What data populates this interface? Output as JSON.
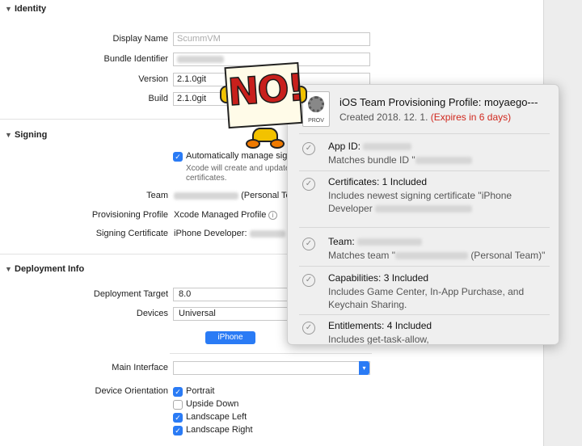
{
  "identity": {
    "header": "Identity",
    "display_name_label": "Display Name",
    "display_name_value": "ScummVM",
    "bundle_id_label": "Bundle Identifier",
    "version_label": "Version",
    "version_value": "2.1.0git",
    "build_label": "Build",
    "build_value": "2.1.0git"
  },
  "signing": {
    "header": "Signing",
    "auto_manage_label": "Automatically manage sign",
    "auto_manage_desc_1": "Xcode will create and update",
    "auto_manage_desc_2": "certificates.",
    "team_label": "Team",
    "team_value_suffix": "(Personal Te",
    "profile_label": "Provisioning Profile",
    "profile_value": "Xcode Managed Profile",
    "certificate_label": "Signing Certificate",
    "certificate_value": "iPhone Developer:"
  },
  "deployment": {
    "header": "Deployment Info",
    "target_label": "Deployment Target",
    "target_value": "8.0",
    "devices_label": "Devices",
    "devices_value": "Universal",
    "iphone_tab": "iPhone",
    "main_interface_label": "Main Interface",
    "orientation_label": "Device Orientation",
    "orientations": [
      {
        "label": "Portrait",
        "checked": true
      },
      {
        "label": "Upside Down",
        "checked": false
      },
      {
        "label": "Landscape Left",
        "checked": true
      },
      {
        "label": "Landscape Right",
        "checked": true
      }
    ]
  },
  "popover": {
    "title": "iOS Team Provisioning Profile: moyaego---",
    "created": "Created 2018. 12. 1.",
    "expires": "(Expires in 6 days)",
    "icon_label": "PROV",
    "items": [
      {
        "title": "App ID:",
        "desc": "Matches bundle ID \""
      },
      {
        "title": "Certificates: 1 Included",
        "desc": "Includes newest signing certificate \"iPhone Developer"
      },
      {
        "title": "Team:",
        "desc": "Matches team \"",
        "desc_suffix": "(Personal Team)\""
      },
      {
        "title": "Capabilities: 3 Included",
        "desc": "Includes Game Center, In-App Purchase, and Keychain Sharing."
      },
      {
        "title": "Entitlements: 4 Included",
        "desc": "Includes get-task-allow,"
      }
    ]
  },
  "sticker": {
    "text": "NO!"
  },
  "colors": {
    "accent": "#2a7bf5",
    "expire": "#d0281e"
  }
}
